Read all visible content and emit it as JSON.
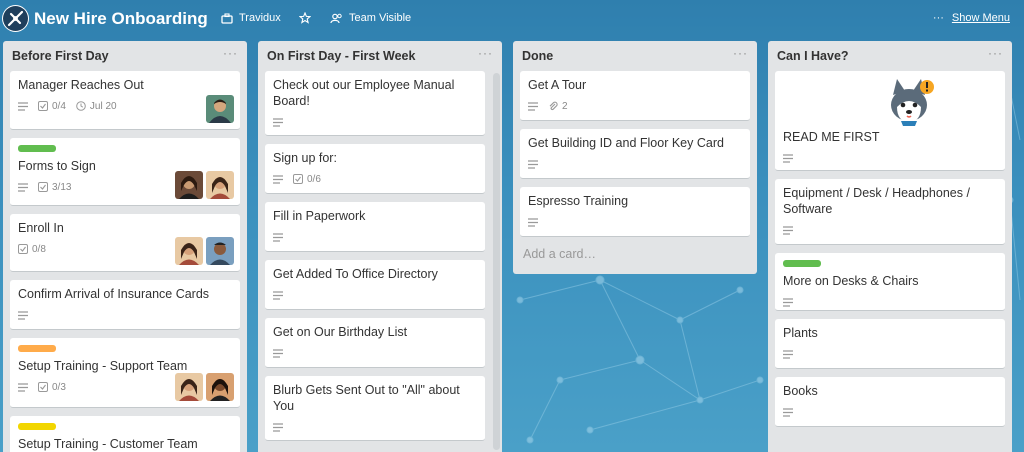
{
  "board": {
    "title": "New Hire Onboarding",
    "team": "Travidux",
    "visibility": "Team Visible",
    "menu_label": "Show Menu",
    "menu_icon": "ellipsis-icon"
  },
  "colors": {
    "green": "#61bd4f",
    "orange": "#ffab4a",
    "yellow": "#f2d600",
    "background": "#3a8fbd"
  },
  "lists": [
    {
      "title": "Before First Day",
      "cards": [
        {
          "title": "Manager Reaches Out",
          "checklist": "0/4",
          "due": "Jul 20"
        },
        {
          "title": "Forms to Sign",
          "label": "green",
          "checklist": "3/13"
        },
        {
          "title": "Enroll In",
          "checklist": "0/8"
        },
        {
          "title": "Confirm Arrival of Insurance Cards"
        },
        {
          "title": "Setup Training - Support Team",
          "label": "orange",
          "checklist": "0/3"
        },
        {
          "title": "Setup Training - Customer Team",
          "label": "yellow"
        }
      ]
    },
    {
      "title": "On First Day - First Week",
      "cards": [
        {
          "title": "Check out our Employee Manual Board!"
        },
        {
          "title": "Sign up for:",
          "checklist": "0/6"
        },
        {
          "title": "Fill in Paperwork"
        },
        {
          "title": "Get Added To Office Directory"
        },
        {
          "title": "Get on Our Birthday List"
        },
        {
          "title": "Blurb Gets Sent Out to \"All\" about You"
        }
      ]
    },
    {
      "title": "Done",
      "cards": [
        {
          "title": "Get A Tour",
          "attachments": "2"
        },
        {
          "title": "Get Building ID and Floor Key Card"
        },
        {
          "title": "Espresso Training"
        }
      ],
      "add_card": "Add a card…"
    },
    {
      "title": "Can I Have?",
      "cards": [
        {
          "title": "READ ME FIRST"
        },
        {
          "title": "Equipment / Desk / Headphones / Software"
        },
        {
          "title": "More on Desks & Chairs",
          "label": "green"
        },
        {
          "title": "Plants"
        },
        {
          "title": "Books"
        }
      ]
    }
  ]
}
